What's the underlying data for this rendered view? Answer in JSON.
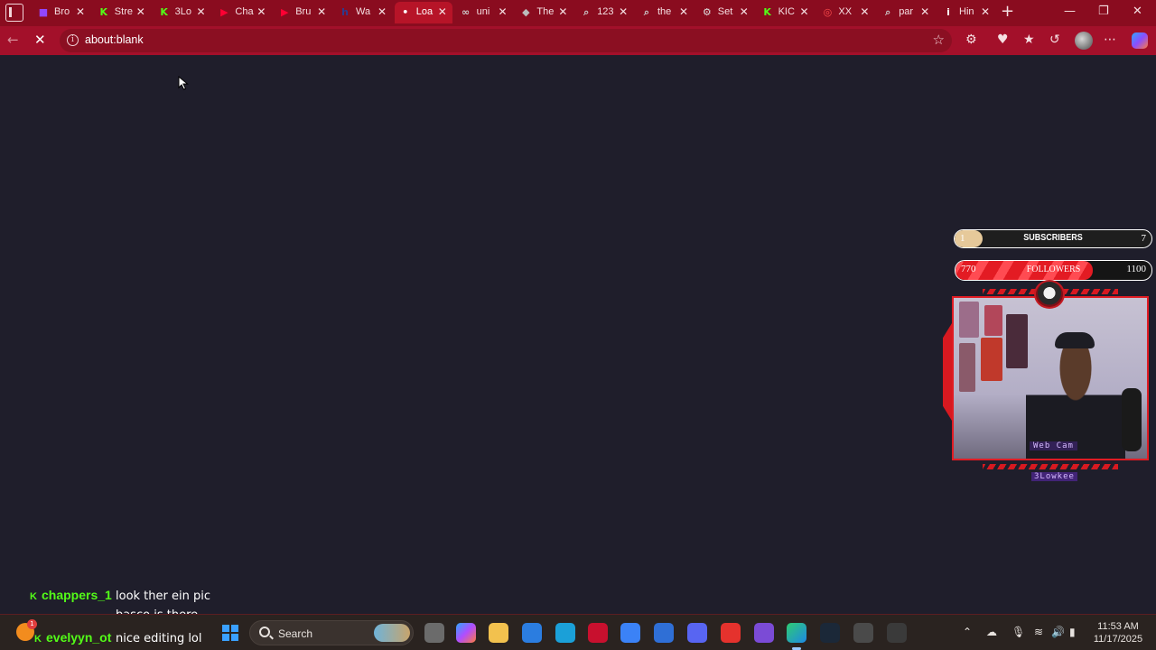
{
  "browser": {
    "tabs": [
      {
        "label": "Bro",
        "icon": "twitch-icon",
        "color": "#9146ff"
      },
      {
        "label": "Stre",
        "icon": "kick-icon",
        "color": "#53fc18"
      },
      {
        "label": "3Lo",
        "icon": "kick-icon",
        "color": "#53fc18"
      },
      {
        "label": "Cha",
        "icon": "youtube-icon",
        "color": "#ff0033"
      },
      {
        "label": "Bru",
        "icon": "youtube-icon",
        "color": "#ff0033"
      },
      {
        "label": "Wa",
        "icon": "hanime-icon",
        "color": "#2b3a8f"
      },
      {
        "label": "Loa",
        "icon": "loading-icon",
        "color": "#ffffff",
        "active": true
      },
      {
        "label": "uni",
        "icon": "link-icon",
        "color": "#cccccc"
      },
      {
        "label": "The",
        "icon": "diamond-icon",
        "color": "#bbbbbb"
      },
      {
        "label": "123",
        "icon": "search-icon",
        "color": "#cccccc"
      },
      {
        "label": "the",
        "icon": "search-icon",
        "color": "#cccccc"
      },
      {
        "label": "Set",
        "icon": "gear-icon",
        "color": "#dddddd"
      },
      {
        "label": "KIC",
        "icon": "kick-icon",
        "color": "#53fc18"
      },
      {
        "label": "XX",
        "icon": "circle-icon",
        "color": "#ff4d4d"
      },
      {
        "label": "par",
        "icon": "search-icon",
        "color": "#cccccc"
      },
      {
        "label": "Hin",
        "icon": "info-icon",
        "color": "#ffffff"
      }
    ],
    "new_tab_symbol": "+",
    "address": "about:blank",
    "accent": "#a3102a"
  },
  "overlay": {
    "subscribers": {
      "label": "SUBSCRIBERS",
      "current": "1",
      "goal": "7",
      "progress": 0.14
    },
    "followers": {
      "label": "FOLLOWERS",
      "current": "770",
      "goal": "1100",
      "progress": 0.7
    },
    "webcam_label": "Web Cam",
    "streamer_name": "3Lowkee"
  },
  "chat": [
    {
      "user": "chappers_1",
      "messages": [
        "look ther ein pic",
        "basco is there"
      ]
    },
    {
      "user": "evelyyn_ot",
      "messages": [
        "nice editing lol"
      ]
    }
  ],
  "taskbar": {
    "search_label": "Search",
    "notification_count": "1",
    "time": "11:53 AM",
    "date": "11/17/2025"
  }
}
